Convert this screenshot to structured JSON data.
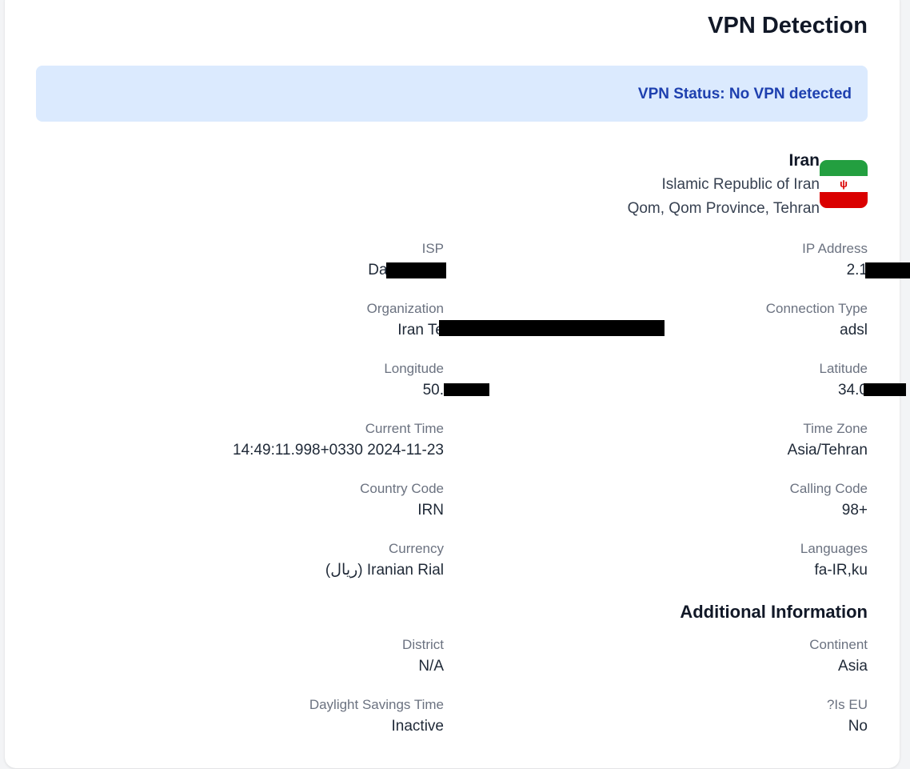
{
  "header": {
    "title": "VPN Detection"
  },
  "status": {
    "text": "VPN Status: No VPN detected"
  },
  "location": {
    "country": "Iran",
    "official_name": "Islamic Republic of Iran",
    "place": "Qom, Qom Province, Tehran",
    "flag_icon": "iran-flag-icon"
  },
  "fields": {
    "isp": {
      "label": "ISP",
      "value": "Data Office"
    },
    "ip_address": {
      "label": "IP Address",
      "value": "2.1"
    },
    "organization": {
      "label": "Organization",
      "value": "Iran Te"
    },
    "connection_type": {
      "label": "Connection Type",
      "value": "adsl"
    },
    "longitude": {
      "label": "Longitude",
      "value": "50."
    },
    "latitude": {
      "label": "Latitude",
      "value": "34.0"
    },
    "current_time": {
      "label": "Current Time",
      "value": "14:49:11.998+0330 2024-11-23"
    },
    "time_zone": {
      "label": "Time Zone",
      "value": "Asia/Tehran"
    },
    "country_code": {
      "label": "Country Code",
      "value": "IRN"
    },
    "calling_code": {
      "label": "Calling Code",
      "value": "98+"
    },
    "currency": {
      "label": "Currency",
      "value": "(ريال) Iranian Rial"
    },
    "languages": {
      "label": "Languages",
      "value": "fa-IR,ku"
    }
  },
  "additional": {
    "title": "Additional Information",
    "district": {
      "label": "District",
      "value": "N/A"
    },
    "continent": {
      "label": "Continent",
      "value": "Asia"
    },
    "daylight_savings": {
      "label": "Daylight Savings Time",
      "value": "Inactive"
    },
    "is_eu": {
      "label": "?Is EU",
      "value": "No"
    }
  },
  "colors": {
    "status_bg": "#dbeafe",
    "status_text": "#1e40af",
    "label": "#6b7280",
    "value": "#1f2937",
    "heading": "#111827"
  }
}
